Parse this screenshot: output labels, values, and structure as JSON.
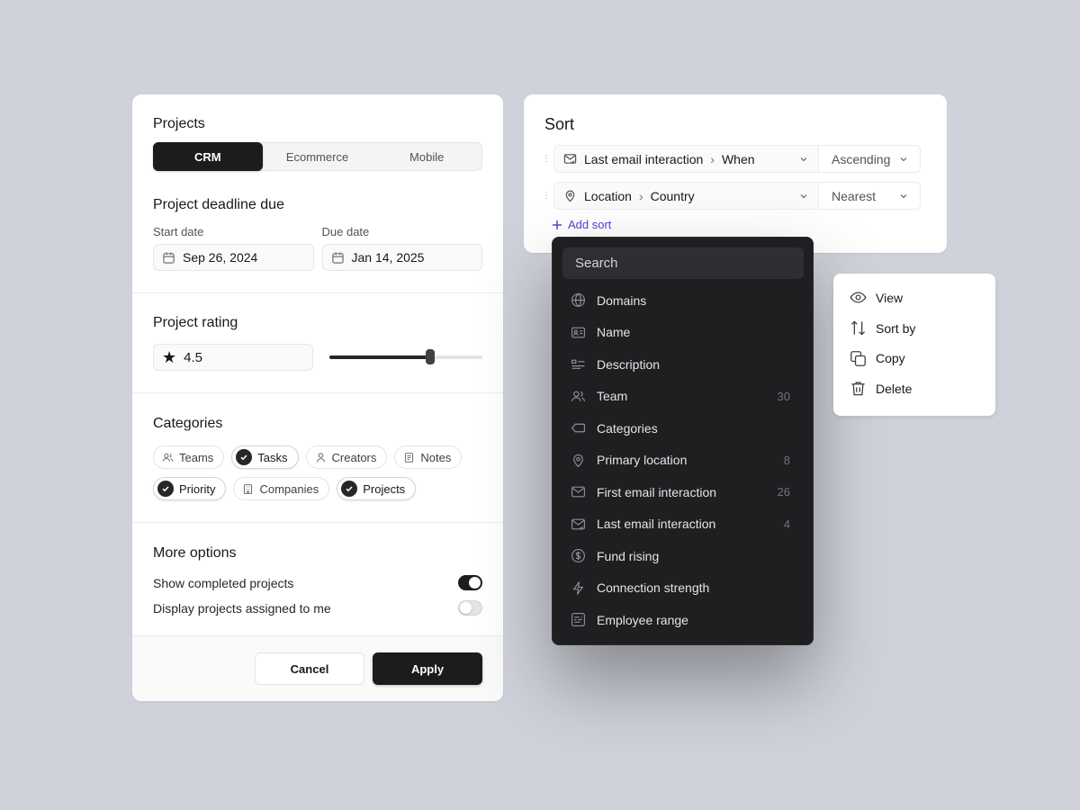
{
  "projects": {
    "title": "Projects",
    "tabs": [
      {
        "label": "CRM",
        "active": true
      },
      {
        "label": "Ecommerce",
        "active": false
      },
      {
        "label": "Mobile",
        "active": false
      }
    ]
  },
  "deadline": {
    "title": "Project deadline due",
    "start_label": "Start date",
    "start_value": "Sep 26, 2024",
    "due_label": "Due date",
    "due_value": "Jan 14, 2025"
  },
  "rating": {
    "title": "Project rating",
    "value": "4.5",
    "slider_fraction": 0.66
  },
  "categories": {
    "title": "Categories",
    "chips": [
      {
        "label": "Teams",
        "selected": false,
        "icon": "users-icon"
      },
      {
        "label": "Tasks",
        "selected": true,
        "icon": "check-icon"
      },
      {
        "label": "Creators",
        "selected": false,
        "icon": "user-icon"
      },
      {
        "label": "Notes",
        "selected": false,
        "icon": "note-icon"
      },
      {
        "label": "Priority",
        "selected": true,
        "icon": "check-icon"
      },
      {
        "label": "Companies",
        "selected": false,
        "icon": "building-icon"
      },
      {
        "label": "Projects",
        "selected": true,
        "icon": "check-icon"
      }
    ]
  },
  "more": {
    "title": "More options",
    "opt1": "Show completed projects",
    "opt1_on": true,
    "opt2": "Display projects assigned to me",
    "opt2_on": false
  },
  "footer": {
    "cancel": "Cancel",
    "apply": "Apply"
  },
  "sort": {
    "title": "Sort",
    "rows": [
      {
        "field": "Last email interaction",
        "sub": "When",
        "direction": "Ascending",
        "icon": "mail-icon"
      },
      {
        "field": "Location",
        "sub": "Country",
        "direction": "Nearest",
        "icon": "pin-icon"
      }
    ],
    "add_label": "Add sort"
  },
  "menu": {
    "search_placeholder": "Search",
    "items": [
      {
        "label": "Domains",
        "count": "",
        "icon": "globe-icon"
      },
      {
        "label": "Name",
        "count": "",
        "icon": "id-card-icon"
      },
      {
        "label": "Description",
        "count": "",
        "icon": "description-icon"
      },
      {
        "label": "Team",
        "count": "30",
        "icon": "users-icon"
      },
      {
        "label": "Categories",
        "count": "",
        "icon": "tag-icon"
      },
      {
        "label": "Primary location",
        "count": "8",
        "icon": "pin-icon"
      },
      {
        "label": "First email interaction",
        "count": "26",
        "icon": "mail-icon"
      },
      {
        "label": "Last email interaction",
        "count": "4",
        "icon": "mail-check-icon"
      },
      {
        "label": "Fund rising",
        "count": "",
        "icon": "dollar-icon"
      },
      {
        "label": "Connection strength",
        "count": "",
        "icon": "bolt-icon"
      },
      {
        "label": "Employee range",
        "count": "",
        "icon": "range-icon"
      }
    ]
  },
  "context_menu": {
    "items": [
      {
        "label": "View",
        "icon": "eye-icon"
      },
      {
        "label": "Sort by",
        "icon": "sort-icon"
      },
      {
        "label": "Copy",
        "icon": "copy-icon"
      },
      {
        "label": "Delete",
        "icon": "trash-icon"
      }
    ]
  }
}
